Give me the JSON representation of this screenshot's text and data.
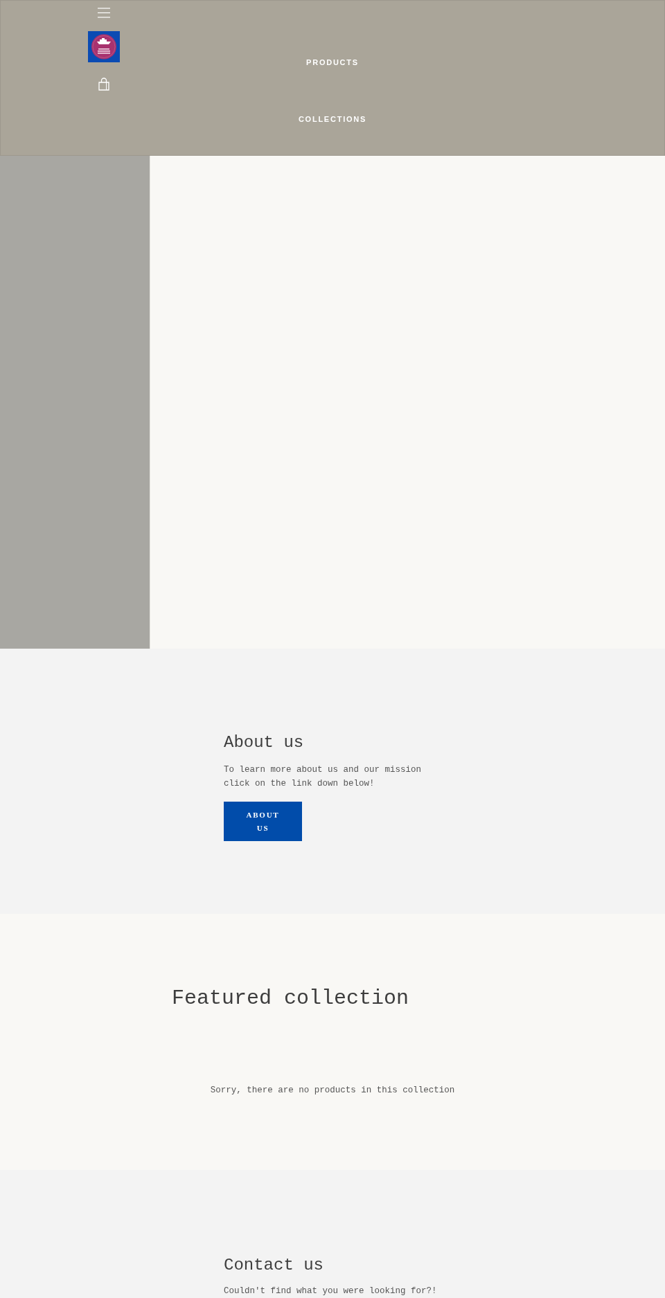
{
  "header": {
    "nav_links": [
      "PRODUCTS",
      "COLLECTIONS"
    ]
  },
  "about": {
    "heading": "About us",
    "text": "To learn more about us and our mission click on the link down below!",
    "button": "ABOUT US"
  },
  "featured_collection": {
    "heading": "Featured collection",
    "empty_message": "Sorry, there are no products in this collection"
  },
  "contact": {
    "heading": "Contact us",
    "text": "Couldn't find what you were looking for?!"
  }
}
